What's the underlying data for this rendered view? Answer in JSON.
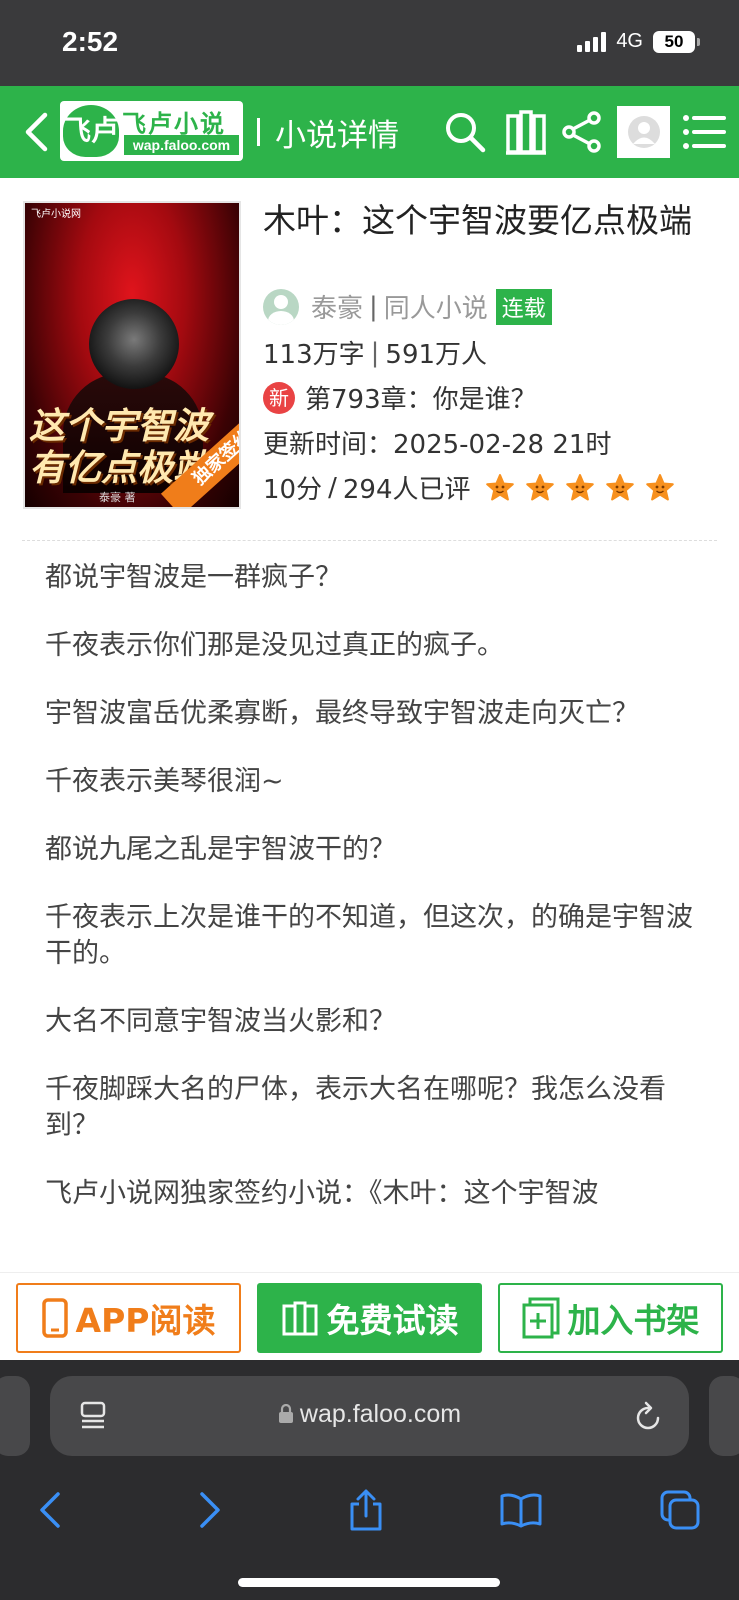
{
  "status_bar": {
    "time": "2:52",
    "network": "4G",
    "battery": "50"
  },
  "header": {
    "logo_title": "飞卢小说",
    "logo_mark": "飞卢",
    "logo_url": "wap.faloo.com",
    "title": "小说详情",
    "icons": [
      "back-icon",
      "search-icon",
      "bookshelf-icon",
      "share-icon",
      "user-avatar-icon",
      "menu-icon"
    ]
  },
  "book": {
    "cover": {
      "site": "飞卢小说网",
      "title": "这个宇智波有亿点极端",
      "ribbon": "独家签约",
      "author": "泰豪 著"
    },
    "title": "木叶：这个宇智波要亿点极端",
    "author": "泰豪",
    "genre": "同人小说",
    "status": "连载",
    "word_count": "113万字",
    "readers": "591万人",
    "new_badge": "新",
    "latest_chapter": "第793章：你是谁？",
    "update_time": "更新时间：2025-02-28 21时",
    "score": "10分",
    "rating_count": "294人已评",
    "stars": 5
  },
  "intro": [
    "都说宇智波是一群疯子？",
    "千夜表示你们那是没见过真正的疯子。",
    "宇智波富岳优柔寡断，最终导致宇智波走向灭亡？",
    "千夜表示美琴很润~",
    "都说九尾之乱是宇智波干的？",
    "千夜表示上次是谁干的不知道，但这次，的确是宇智波干的。",
    "大名不同意宇智波当火影和？",
    "千夜脚踩大名的尸体，表示大名在哪呢？我怎么没看到？",
    "飞卢小说网独家签约小说：《木叶：这个宇智波"
  ],
  "actions": {
    "app_read": "APP阅读",
    "free_read": "免费试读",
    "add_shelf": "加入书架"
  },
  "browser": {
    "url": "wap.faloo.com"
  },
  "colors": {
    "brand_green": "#2db34a",
    "accent_orange": "#f07d1a",
    "new_red": "#e94344"
  }
}
